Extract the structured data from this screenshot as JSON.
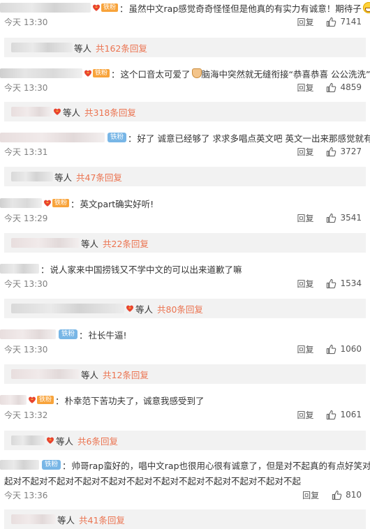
{
  "labels": {
    "reply": "回复",
    "more_replies_prefix": "等人"
  },
  "colors": {
    "fan_badge": "#f8a33a",
    "iron_badge": "#78b6e6",
    "reply_count": "#eb7350",
    "replies_bg": "#f2f2f2"
  },
  "comments": [
    {
      "badge": "铁粉",
      "badge_kind": "fan",
      "lines": [
        "虽然中文rap感觉奇奇怪怪但是他真的有实力有诚意！期待子"
      ],
      "emoji": "grin-emoji",
      "time": "今天 13:30",
      "likes": "7141",
      "more_replies": "共162条回复"
    },
    {
      "badge": "铁粉",
      "badge_kind": "fan",
      "lines": [
        "这个口音太可爱了"
      ],
      "emoji_mid": "pray-emoji",
      "text_after_emoji": "脑海中突然就无缝衔接“恭喜恭喜 公公洗洗”",
      "time": "今天 13:30",
      "likes": "4859",
      "more_replies": "共318条回复"
    },
    {
      "badge": "铁粉",
      "badge_kind": "iron",
      "lines": [
        "好了 诚意已经够了 求求多唱点英文吧 英文一出来那感觉就有了"
      ],
      "time": "今天 13:31",
      "likes": "3727",
      "more_replies": "共47条回复"
    },
    {
      "badge": "铁粉",
      "badge_kind": "fan",
      "lines": [
        "英文part确实好听!"
      ],
      "time": "今天 13:29",
      "likes": "3541",
      "more_replies": "共22条回复"
    },
    {
      "badge": "",
      "badge_kind": "none",
      "lines": [
        "说人家来中国捞钱又不学中文的可以出来道歉了嘛"
      ],
      "time": "今天 13:30",
      "likes": "1534",
      "more_replies": "共80条回复"
    },
    {
      "badge": "铁粉",
      "badge_kind": "iron",
      "lines": [
        "社长牛逼!"
      ],
      "time": "今天 13:30",
      "likes": "1060",
      "more_replies": "共12条回复"
    },
    {
      "badge": "铁粉",
      "badge_kind": "fan",
      "lines": [
        "朴幸范下苦功夫了，诚意我感受到了"
      ],
      "time": "今天 13:32",
      "likes": "1061",
      "more_replies": "共6条回复"
    },
    {
      "badge": "铁粉",
      "badge_kind": "iron",
      "lines": [
        "帅哥rap蛮好的，唱中文rap也很用心很有诚意了，但是对不起真的有点好笑对不",
        "起对不起对不起对不起对不起对不起对不起对不起对不起对不起对不起对不起"
      ],
      "time": "今天 13:36",
      "likes": "810",
      "more_replies": "共41条回复"
    }
  ]
}
